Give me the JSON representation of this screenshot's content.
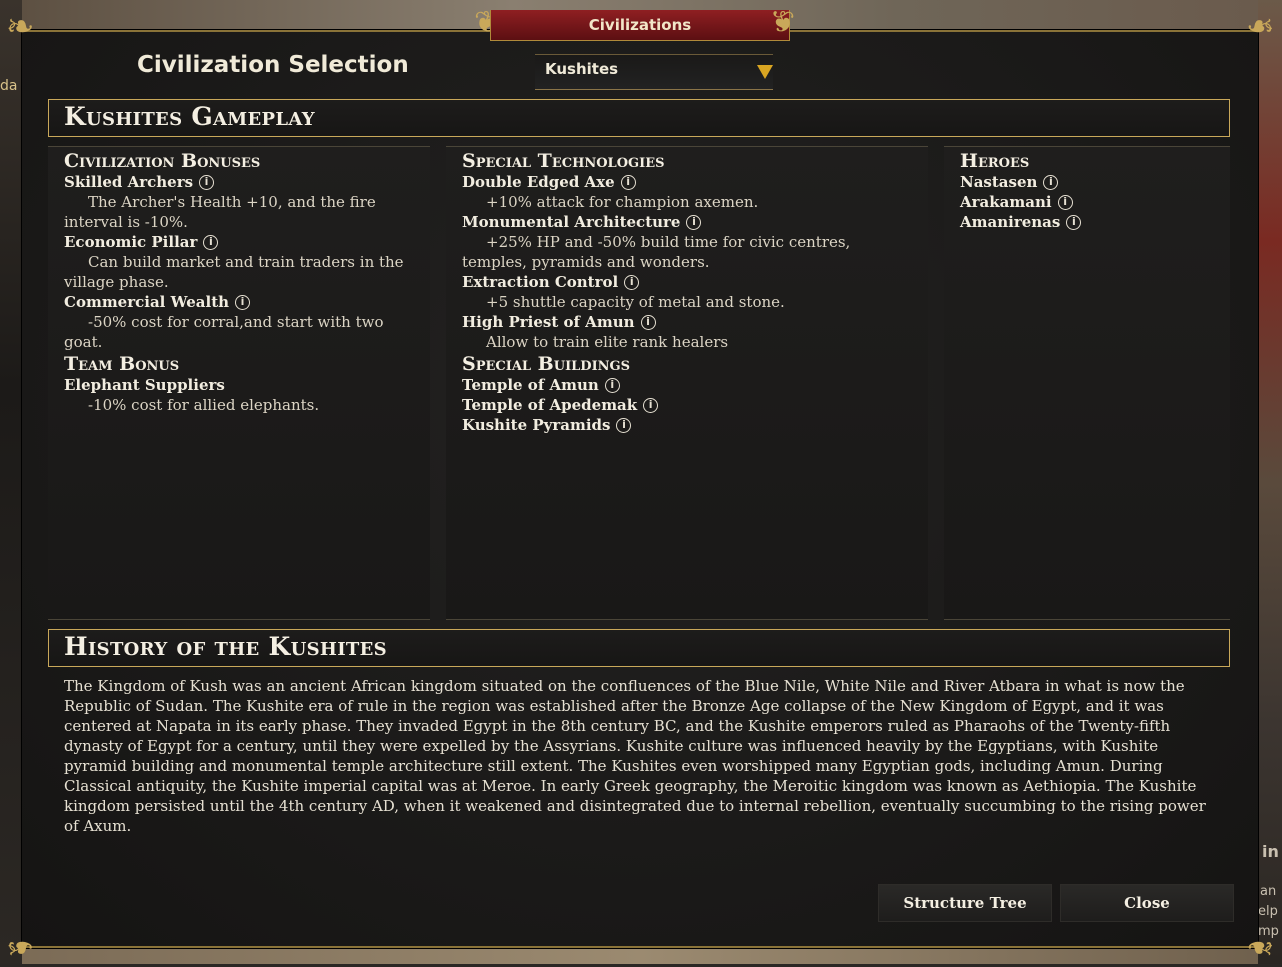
{
  "window": {
    "title": "Civilizations"
  },
  "background": {
    "left_fragment": "da",
    "right_fragments": [
      "in",
      "an",
      "elp",
      "mp"
    ]
  },
  "selector": {
    "label": "Civilization Selection",
    "value": "Kushites"
  },
  "gameplay": {
    "title": "Kushites Gameplay",
    "columns": [
      {
        "sections": [
          {
            "title": "Civilization Bonuses",
            "items": [
              {
                "name": "Skilled Archers",
                "desc": "The Archer's Health +10, and the fire interval is -10%."
              },
              {
                "name": "Economic Pillar",
                "desc": "Can build market and train traders in the village phase."
              },
              {
                "name": "Commercial Wealth",
                "desc": "-50% cost for corral,and start with two goat."
              }
            ]
          },
          {
            "title": "Team Bonus",
            "items": [
              {
                "name": "Elephant Suppliers",
                "desc": "-10% cost for allied elephants."
              }
            ]
          }
        ]
      },
      {
        "sections": [
          {
            "title": "Special Technologies",
            "items": [
              {
                "name": "Double Edged Axe",
                "desc": "+10% attack for champion axemen."
              },
              {
                "name": "Monumental Architecture",
                "desc": "+25% HP and -50% build time for civic centres, temples, pyramids and wonders."
              },
              {
                "name": "Extraction Control",
                "desc": "+5 shuttle capacity of metal and stone."
              },
              {
                "name": "High Priest of Amun",
                "desc": "Allow to train elite rank healers"
              }
            ]
          },
          {
            "title": "Special Buildings",
            "items": [
              {
                "name": "Temple of Amun",
                "desc": ""
              },
              {
                "name": "Temple of Apedemak",
                "desc": ""
              },
              {
                "name": "Kushite Pyramids",
                "desc": ""
              }
            ]
          }
        ]
      },
      {
        "sections": [
          {
            "title": "Heroes",
            "items": [
              {
                "name": "Nastasen",
                "desc": ""
              },
              {
                "name": "Arakamani",
                "desc": ""
              },
              {
                "name": "Amanirenas",
                "desc": ""
              }
            ]
          }
        ]
      }
    ]
  },
  "history": {
    "title": "History of the Kushites",
    "text": "The Kingdom of Kush was an ancient African kingdom situated on the confluences of the Blue Nile, White Nile and River Atbara in what is now the Republic of Sudan. The Kushite era of rule in the region was established after the Bronze Age collapse of the New Kingdom of Egypt, and it was centered at Napata in its early phase. They invaded Egypt in the 8th century BC, and the Kushite emperors ruled as Pharaohs of the Twenty-fifth dynasty of Egypt for a century, until they were expelled by the Assyrians. Kushite culture was influenced heavily by the Egyptians, with Kushite pyramid building and monumental temple architecture still extent. The Kushites even worshipped many Egyptian gods, including Amun. During Classical antiquity, the Kushite imperial capital was at Meroe. In early Greek geography, the Meroitic kingdom was known as Aethiopia. The Kushite kingdom persisted until the 4th century AD, when it weakened and disintegrated due to internal rebellion, eventually succumbing to the rising power of Axum."
  },
  "buttons": {
    "structure_tree": "Structure Tree",
    "close": "Close"
  },
  "icons": {
    "info": "i",
    "ornament": "❦",
    "corner": "❧"
  },
  "colors": {
    "accent_gold": "#c9a85a",
    "title_red": "#8f1f22",
    "dropdown_arrow": "#d9a522"
  }
}
